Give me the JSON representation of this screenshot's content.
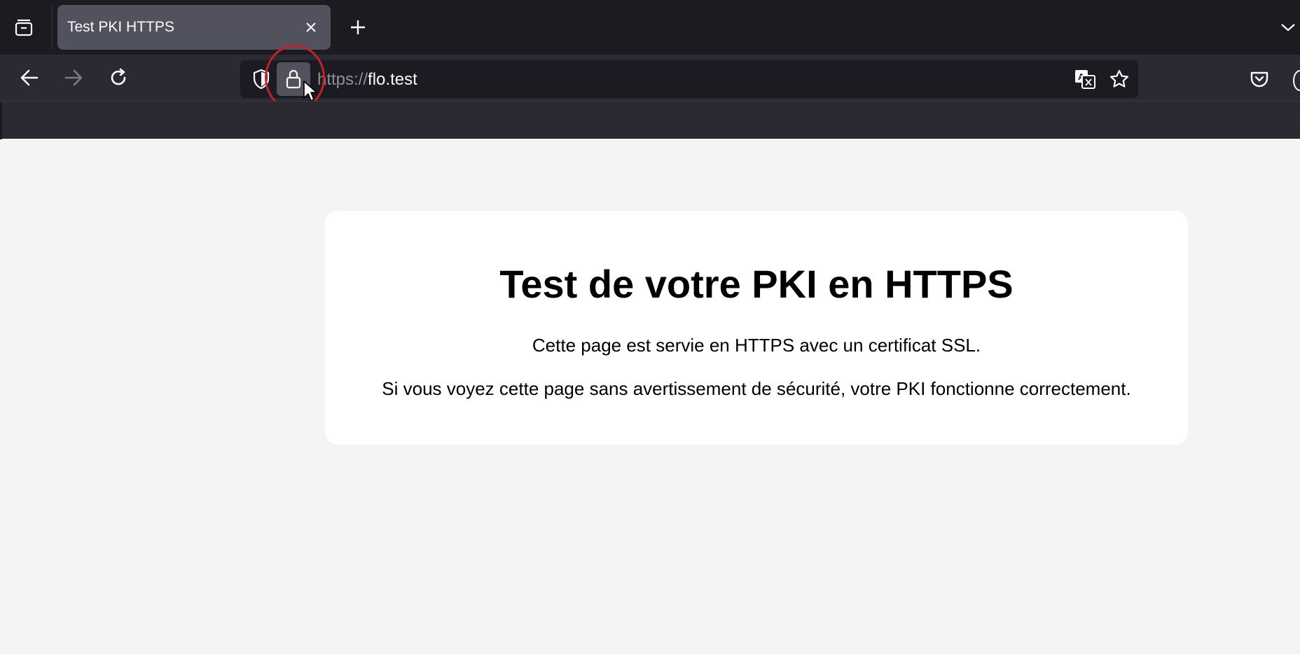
{
  "browser": {
    "tab": {
      "title": "Test PKI HTTPS"
    },
    "url": {
      "scheme": "https://",
      "host": "flo.test"
    },
    "icons": {
      "tab_overview": "firefox-view-icon",
      "tab_close": "close-icon",
      "new_tab": "plus-icon",
      "tab_list": "chevron-down-icon",
      "back": "back-arrow-icon",
      "forward": "forward-arrow-icon",
      "reload": "reload-icon",
      "tracking_protection": "shield-icon",
      "site_security": "lock-icon",
      "translate": "translate-icon",
      "bookmark": "star-icon",
      "pocket": "pocket-icon"
    },
    "colors": {
      "tabstrip_bg": "#1c1b22",
      "toolbar_bg": "#2b2a33",
      "selected_tab_bg": "#52515e",
      "highlight_ring": "#c0232a"
    }
  },
  "page": {
    "heading": "Test de votre PKI en HTTPS",
    "paragraph1": "Cette page est servie en HTTPS avec un certificat SSL.",
    "paragraph2": "Si vous voyez cette page sans avertissement de sécurité, votre PKI fonctionne correctement.",
    "colors": {
      "page_bg": "#f4f4f4",
      "card_bg": "#ffffff"
    }
  }
}
